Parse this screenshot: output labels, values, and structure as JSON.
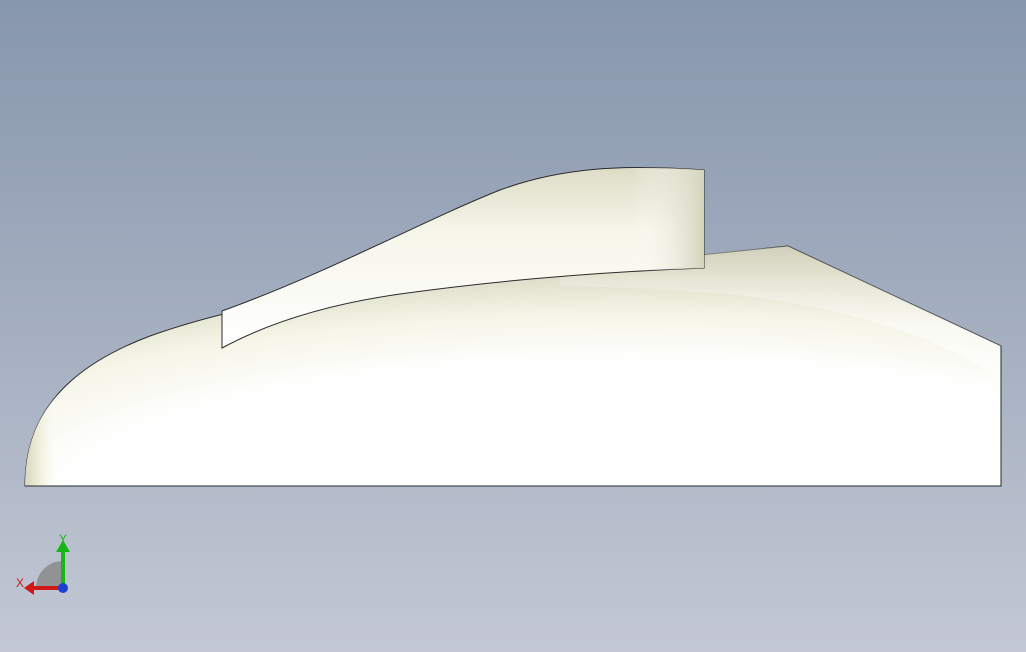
{
  "viewport": {
    "background_top": "#8797ac",
    "background_bottom": "#c3c8d4"
  },
  "model": {
    "name": "car-body-shell",
    "face_color": "#fbfbf2",
    "edge_color": "#2a2a2a"
  },
  "triad": {
    "x_label": "X",
    "y_label": "Y",
    "x_color": "#d01818",
    "y_color": "#17b617",
    "z_color": "#1c3fd0"
  }
}
